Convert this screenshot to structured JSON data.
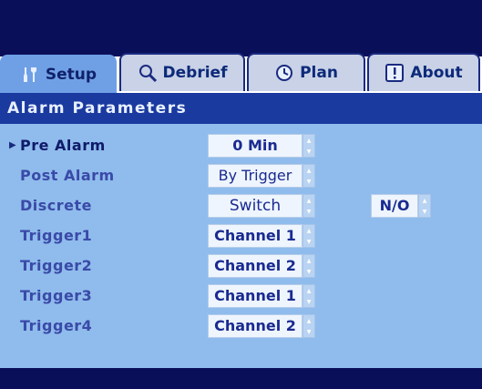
{
  "tabs": [
    {
      "label": "Setup",
      "icon": "tools-icon",
      "active": true
    },
    {
      "label": "Debrief",
      "icon": "magnifier-icon",
      "active": false
    },
    {
      "label": "Plan",
      "icon": "clock-icon",
      "active": false
    },
    {
      "label": "About",
      "icon": "info-icon",
      "active": false
    }
  ],
  "section": {
    "title": "Alarm Parameters"
  },
  "rows": [
    {
      "label": "Pre Alarm",
      "value": "0  Min",
      "selected": true
    },
    {
      "label": "Post Alarm",
      "value": "By Trigger"
    },
    {
      "label": "Discrete",
      "value": "Switch",
      "extra_value": "N/O"
    },
    {
      "label": "Trigger1",
      "value": "Channel 1"
    },
    {
      "label": "Trigger2",
      "value": "Channel 2"
    },
    {
      "label": "Trigger3",
      "value": "Channel 1"
    },
    {
      "label": "Trigger4",
      "value": "Channel 2"
    }
  ],
  "colors": {
    "frame": "#0a0f5a",
    "section_bar": "#1a3aa0",
    "panel": "#8fbcec",
    "active_tab": "#6fa0e6",
    "inactive_tab": "#c9d2e6"
  }
}
